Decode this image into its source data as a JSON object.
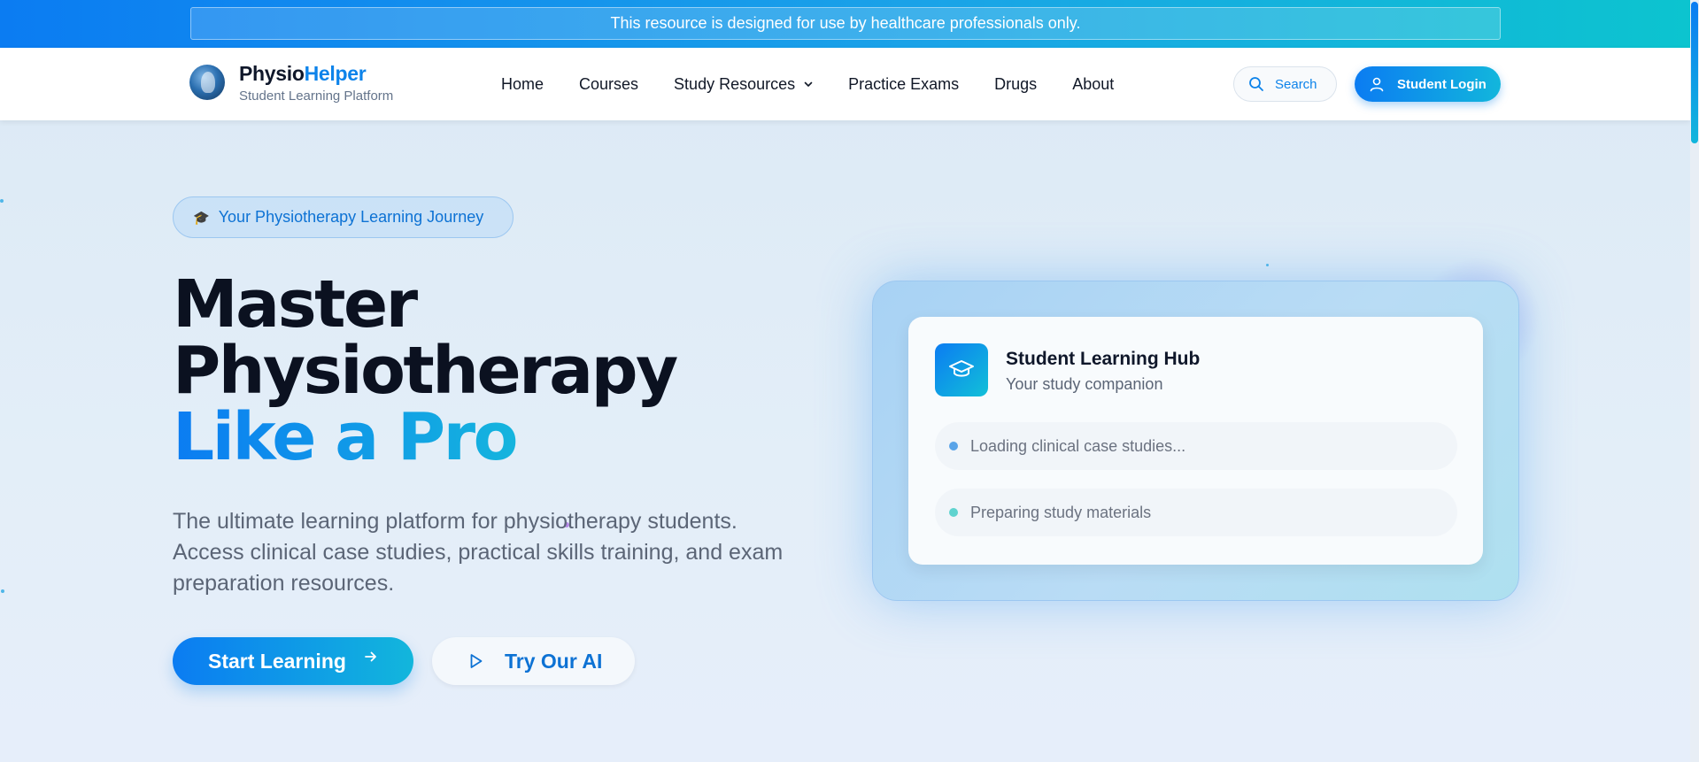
{
  "banner": {
    "text": "This resource is designed for use by healthcare professionals only."
  },
  "brand": {
    "name_part1": "Physio",
    "name_part2": "Helper",
    "subtitle": "Student Learning Platform"
  },
  "nav": {
    "items": [
      {
        "label": "Home"
      },
      {
        "label": "Courses"
      },
      {
        "label": "Study Resources",
        "has_dropdown": true
      },
      {
        "label": "Practice Exams"
      },
      {
        "label": "Drugs"
      },
      {
        "label": "About"
      }
    ]
  },
  "header_actions": {
    "search_label": "Search",
    "login_label": "Student Login"
  },
  "hero": {
    "pill_label": "Your Physiotherapy Learning Journey",
    "title_line1": "Master",
    "title_line2": "Physiotherapy",
    "title_line3": "Like a Pro",
    "description": "The ultimate learning platform for physiotherapy students. Access clinical case studies, practical skills training, and exam preparation resources.",
    "start_label": "Start Learning",
    "ai_label": "Try Our AI"
  },
  "hub": {
    "title": "Student Learning Hub",
    "subtitle": "Your study companion",
    "rows": [
      {
        "text": "Loading clinical case studies...",
        "dot_color": "#5aa4e8"
      },
      {
        "text": "Preparing study materials",
        "dot_color": "#5fd3cf"
      }
    ]
  },
  "icons": {
    "search": "search-icon",
    "user": "user-icon",
    "chevron": "chevron-down-icon",
    "arrow": "arrow-right-icon",
    "play": "play-icon",
    "cap": "graduation-cap-icon"
  },
  "colors": {
    "accent": "#0d83ea",
    "accent_end": "#12b6dc",
    "text_dark": "#0f172a"
  }
}
